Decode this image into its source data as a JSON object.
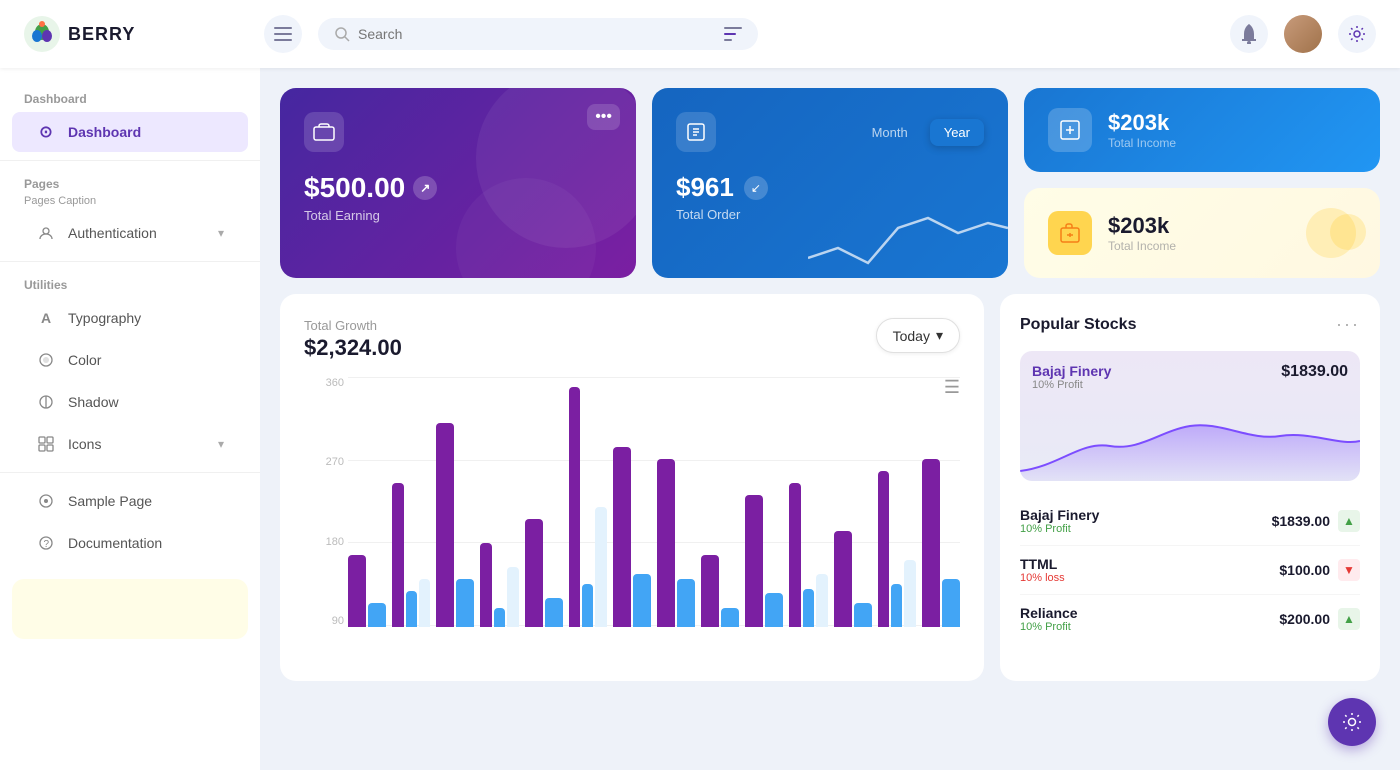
{
  "header": {
    "logo_text": "BERRY",
    "search_placeholder": "Search",
    "menu_icon": "☰"
  },
  "sidebar": {
    "section_dashboard": "Dashboard",
    "section_pages": "Pages",
    "section_pages_caption": "Pages Caption",
    "section_utilities": "Utilities",
    "nav_items": [
      {
        "id": "dashboard",
        "label": "Dashboard",
        "icon": "⊙",
        "active": true
      },
      {
        "id": "authentication",
        "label": "Authentication",
        "icon": "⚲",
        "chevron": "▾"
      },
      {
        "id": "typography",
        "label": "Typography",
        "icon": "A"
      },
      {
        "id": "color",
        "label": "Color",
        "icon": "◎"
      },
      {
        "id": "shadow",
        "label": "Shadow",
        "icon": "◉"
      },
      {
        "id": "icons",
        "label": "Icons",
        "icon": "✦",
        "chevron": "▾"
      },
      {
        "id": "sample-page",
        "label": "Sample Page",
        "icon": "◎"
      },
      {
        "id": "documentation",
        "label": "Documentation",
        "icon": "?"
      }
    ]
  },
  "earning_card": {
    "amount": "$500.00",
    "label": "Total Earning",
    "more": "•••"
  },
  "order_card": {
    "amount": "$961",
    "label": "Total Order",
    "tab_month": "Month",
    "tab_year": "Year"
  },
  "income_card_1": {
    "amount": "$203k",
    "label": "Total Income"
  },
  "income_card_2": {
    "amount": "$203k",
    "label": "Total Income"
  },
  "growth_chart": {
    "title": "Total Growth",
    "amount": "$2,324.00",
    "button_label": "Today",
    "y_labels": [
      "360",
      "270",
      "180",
      "90"
    ],
    "bars": [
      {
        "purple": 30,
        "blue": 10,
        "light": 0
      },
      {
        "purple": 60,
        "blue": 15,
        "light": 20
      },
      {
        "purple": 85,
        "blue": 20,
        "light": 0
      },
      {
        "purple": 35,
        "blue": 8,
        "light": 25
      },
      {
        "purple": 45,
        "blue": 12,
        "light": 0
      },
      {
        "purple": 100,
        "blue": 18,
        "light": 50
      },
      {
        "purple": 75,
        "blue": 22,
        "light": 0
      },
      {
        "purple": 70,
        "blue": 20,
        "light": 0
      },
      {
        "purple": 30,
        "blue": 8,
        "light": 0
      },
      {
        "purple": 55,
        "blue": 14,
        "light": 0
      },
      {
        "purple": 60,
        "blue": 16,
        "light": 22
      },
      {
        "purple": 40,
        "blue": 10,
        "light": 0
      },
      {
        "purple": 65,
        "blue": 18,
        "light": 28
      },
      {
        "purple": 70,
        "blue": 20,
        "light": 0
      }
    ]
  },
  "popular_stocks": {
    "title": "Popular Stocks",
    "chart_stock_name": "Bajaj Finery",
    "chart_stock_profit": "10% Profit",
    "chart_stock_price": "$1839.00",
    "stocks": [
      {
        "name": "Bajaj Finery",
        "profit_label": "10% Profit",
        "profit_type": "up",
        "price": "$1839.00"
      },
      {
        "name": "TTML",
        "profit_label": "10% loss",
        "profit_type": "down",
        "price": "$100.00"
      },
      {
        "name": "Reliance",
        "profit_label": "10% Profit",
        "profit_type": "up",
        "price": "$200.00"
      }
    ]
  },
  "colors": {
    "accent_purple": "#5e35b1",
    "accent_blue": "#1976d2",
    "profit_up": "#43a047",
    "profit_down": "#e53935"
  }
}
